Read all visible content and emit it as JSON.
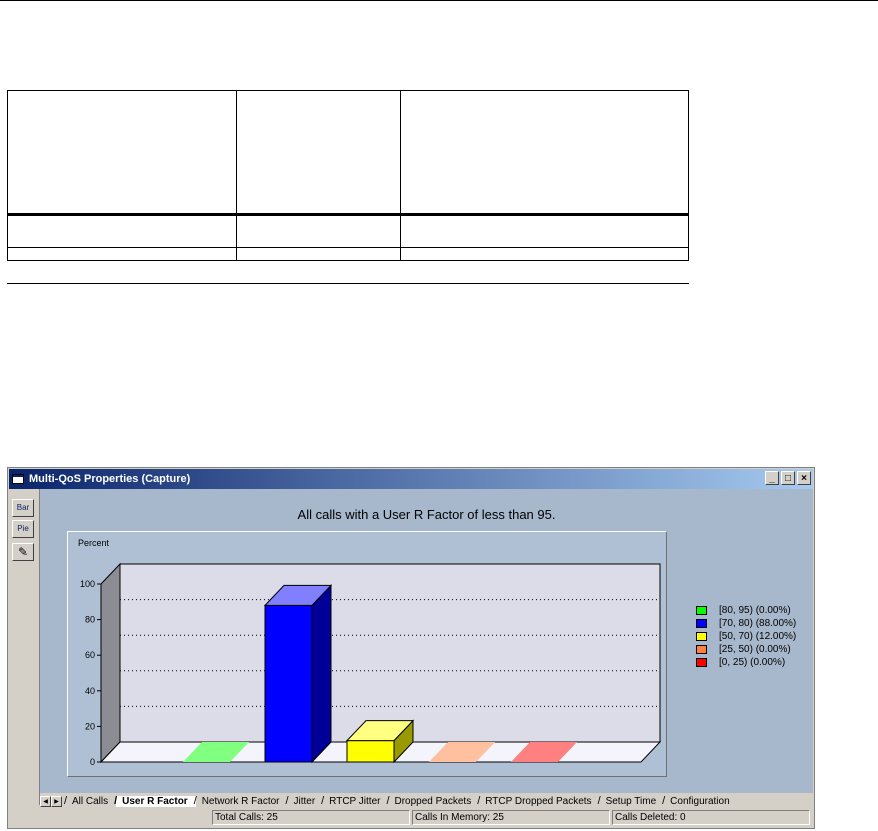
{
  "window": {
    "title": "Multi-QoS Properties (Capture)",
    "buttons": {
      "minimize": "_",
      "maximize": "□",
      "close": "×"
    }
  },
  "toolbar": {
    "bar_label": "Bar",
    "pie_label": "Pie",
    "edit_icon": "pencil-icon"
  },
  "chart_data": {
    "type": "bar",
    "title": "All calls with a User R Factor of less than 95.",
    "ylabel": "Percent",
    "ylim": [
      0,
      100
    ],
    "yticks": [
      0,
      20,
      40,
      60,
      80,
      100
    ],
    "grid": true,
    "legend_position": "right",
    "categories": [
      "[80, 95) (0.00%)",
      "[70, 80) (88.00%)",
      "[50, 70) (12.00%)",
      "[25, 50) (0.00%)",
      "[0, 25) (0.00%)"
    ],
    "values": [
      0,
      88,
      12,
      0,
      0
    ],
    "colors": [
      "#00ff00",
      "#0000ff",
      "#ffff00",
      "#ff8040",
      "#ff0000"
    ]
  },
  "tabs": [
    {
      "label": "All Calls"
    },
    {
      "label": "User R Factor",
      "active": true
    },
    {
      "label": "Network R Factor"
    },
    {
      "label": "Jitter"
    },
    {
      "label": "RTCP Jitter"
    },
    {
      "label": "Dropped Packets"
    },
    {
      "label": "RTCP Dropped Packets"
    },
    {
      "label": "Setup Time"
    },
    {
      "label": "Configuration"
    }
  ],
  "status": {
    "total_calls": "Total Calls: 25",
    "calls_in_memory": "Calls In Memory: 25",
    "calls_deleted": "Calls Deleted: 0"
  }
}
